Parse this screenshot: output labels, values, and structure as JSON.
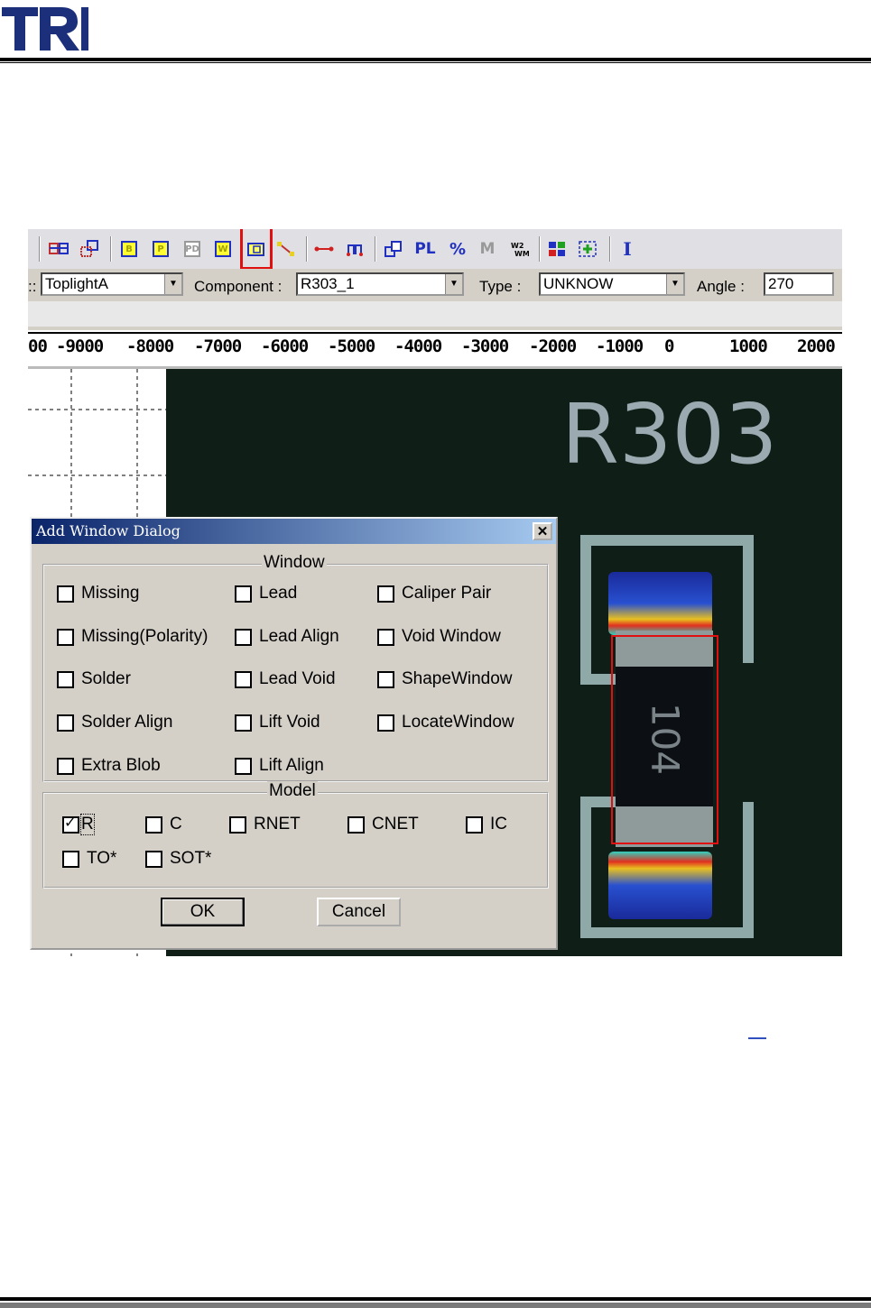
{
  "header": {
    "logo_text": "TRI"
  },
  "toolbar": {
    "buttons": [
      {
        "id": "b",
        "label": "B"
      },
      {
        "id": "p",
        "label": "P"
      },
      {
        "id": "pd",
        "label": "PD"
      },
      {
        "id": "w",
        "label": "W"
      },
      {
        "id": "pl",
        "label": "PL"
      },
      {
        "id": "pct",
        "label": "%"
      },
      {
        "id": "m",
        "label": "M"
      },
      {
        "id": "i",
        "label": "I"
      }
    ],
    "highlighted_button": "add-window"
  },
  "props": {
    "light_value": "ToplightA",
    "component_label": "Component :",
    "component_value": "R303_1",
    "type_label": "Type :",
    "type_value": "UNKNOW",
    "angle_label": "Angle :",
    "angle_value": "270"
  },
  "ruler": {
    "ticks": [
      "00",
      "-9000",
      "-8000",
      "-7000",
      "-6000",
      "-5000",
      "-4000",
      "-3000",
      "-2000",
      "-1000",
      "0",
      "1000",
      "2000"
    ]
  },
  "pcb": {
    "silkscreen": "R303",
    "component_marking": "104"
  },
  "dialog": {
    "title": "Add Window Dialog",
    "window_group": {
      "title": "Window",
      "items": [
        {
          "label": "Missing",
          "checked": false
        },
        {
          "label": "Lead",
          "checked": false
        },
        {
          "label": "Caliper Pair",
          "checked": false
        },
        {
          "label": "Missing(Polarity)",
          "checked": false
        },
        {
          "label": "Lead Align",
          "checked": false
        },
        {
          "label": "Void Window",
          "checked": false
        },
        {
          "label": "Solder",
          "checked": false
        },
        {
          "label": "Lead Void",
          "checked": false
        },
        {
          "label": "ShapeWindow",
          "checked": false
        },
        {
          "label": "Solder Align",
          "checked": false
        },
        {
          "label": "Lift Void",
          "checked": false
        },
        {
          "label": "LocateWindow",
          "checked": false
        },
        {
          "label": "Extra Blob",
          "checked": false
        },
        {
          "label": "Lift Align",
          "checked": false
        }
      ]
    },
    "model_group": {
      "title": "Model",
      "items": [
        {
          "label": "R",
          "checked": true
        },
        {
          "label": "C",
          "checked": false
        },
        {
          "label": "RNET",
          "checked": false
        },
        {
          "label": "CNET",
          "checked": false
        },
        {
          "label": "IC",
          "checked": false
        },
        {
          "label": "TO*",
          "checked": false
        },
        {
          "label": "SOT*",
          "checked": false
        }
      ]
    },
    "ok_label": "OK",
    "cancel_label": "Cancel"
  },
  "colors": {
    "title_bar": "#0a246a",
    "highlight": "#e01010",
    "pcb_board": "#0f1e16",
    "silkscreen": "#9aaab0"
  }
}
